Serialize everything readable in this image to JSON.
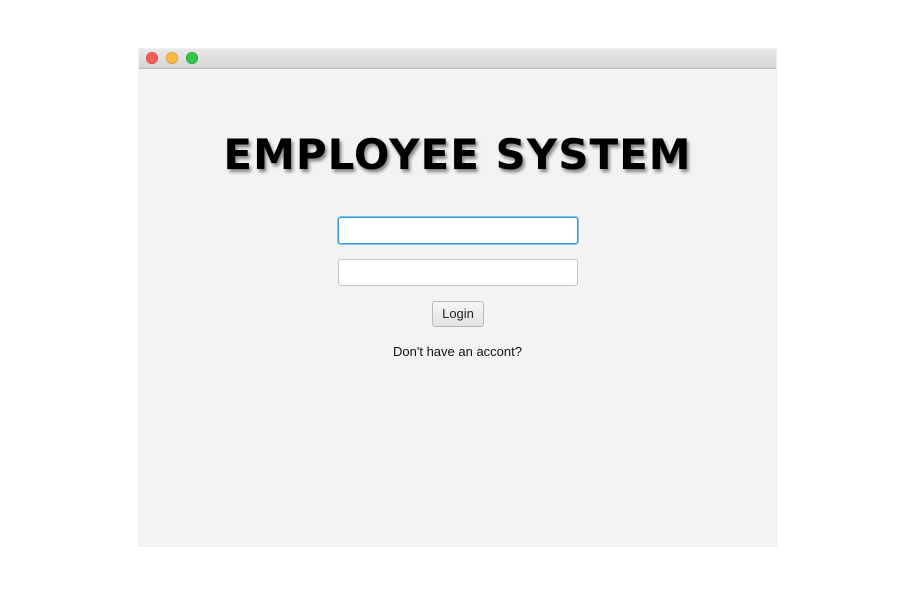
{
  "window": {
    "controls": {
      "close_color": "#fc605c",
      "minimize_color": "#fdbc40",
      "zoom_color": "#34c84a"
    }
  },
  "login_form": {
    "title": "EMPLOYEE SYSTEM",
    "username": {
      "value": "",
      "placeholder": "",
      "focused": true
    },
    "password": {
      "value": "",
      "placeholder": ""
    },
    "login_label": "Login",
    "signup_link": "Don't have an accont?"
  },
  "colors": {
    "window_bg": "#f3f3f3",
    "focus_ring": "#3b9ad9"
  }
}
